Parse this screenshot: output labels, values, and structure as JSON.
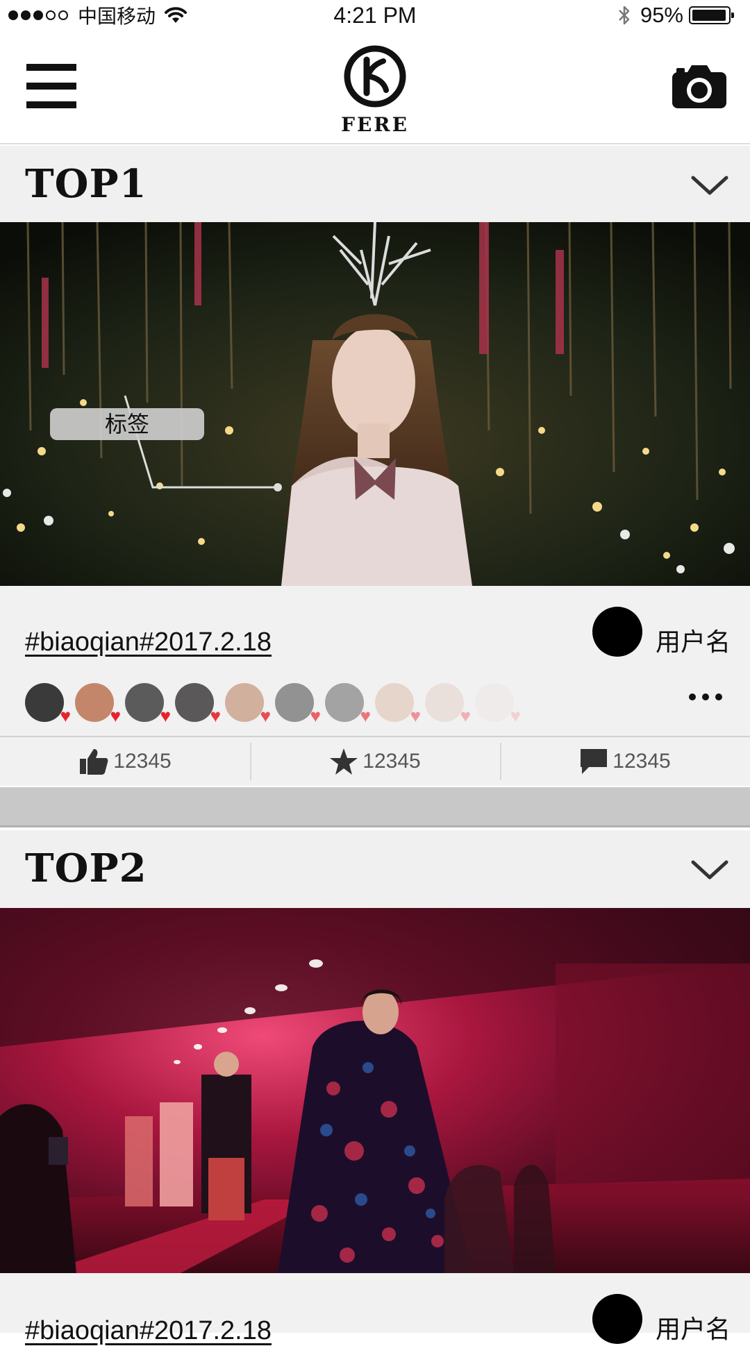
{
  "status_bar": {
    "carrier": "中国移动",
    "time": "4:21 PM",
    "battery": "95%",
    "battery_level": 0.95,
    "signal_bars_filled": 3,
    "signal_bars_total": 5
  },
  "nav": {
    "logo_text": "FERE",
    "menu_icon": "hamburger-menu-icon",
    "camera_icon": "camera-icon"
  },
  "colors": {
    "background": "#ffffff",
    "header_bg": "#f1f0f1",
    "heart": "#e8232c",
    "separator": "#c8c8c8"
  },
  "posts": [
    {
      "title": "TOP1",
      "tag_label": "标签",
      "hashtag": "#biaoqian#2017.2.18",
      "username": "用户名",
      "likes": "12345",
      "favorites": "12345",
      "comments": "12345"
    },
    {
      "title": "TOP2",
      "hashtag": "#biaoqian#2017.2.18",
      "username": "用户名"
    }
  ]
}
